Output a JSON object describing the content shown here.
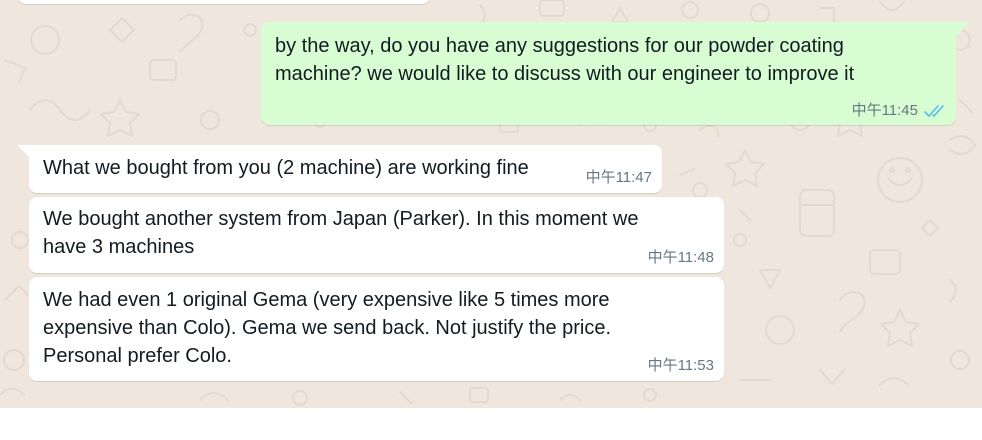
{
  "colors": {
    "chat_background": "#efe7de",
    "incoming_bubble": "#ffffff",
    "outgoing_bubble": "#d9fdd3",
    "message_text": "#111b21",
    "timestamp_text": "#667781",
    "read_ticks": "#53bdeb"
  },
  "messages": [
    {
      "direction": "outgoing",
      "lines": [
        "by the way, do you have any suggestions for our powder coating",
        "machine? we would like to discuss with our engineer to improve it"
      ],
      "time": "中午11:45",
      "status_icon": "double-check-read-icon"
    },
    {
      "direction": "incoming",
      "lines": [
        "What we bought from you (2 machine) are working fine"
      ],
      "time": "中午11:47"
    },
    {
      "direction": "incoming",
      "lines": [
        "We bought another system from Japan (Parker). In this moment we",
        "have 3 machines"
      ],
      "time": "中午11:48"
    },
    {
      "direction": "incoming",
      "lines": [
        "We had even 1 original Gema (very expensive like 5 times more",
        "expensive than Colo). Gema we send back. Not justify the price.",
        "Personal prefer Colo."
      ],
      "time": "中午11:53"
    }
  ]
}
